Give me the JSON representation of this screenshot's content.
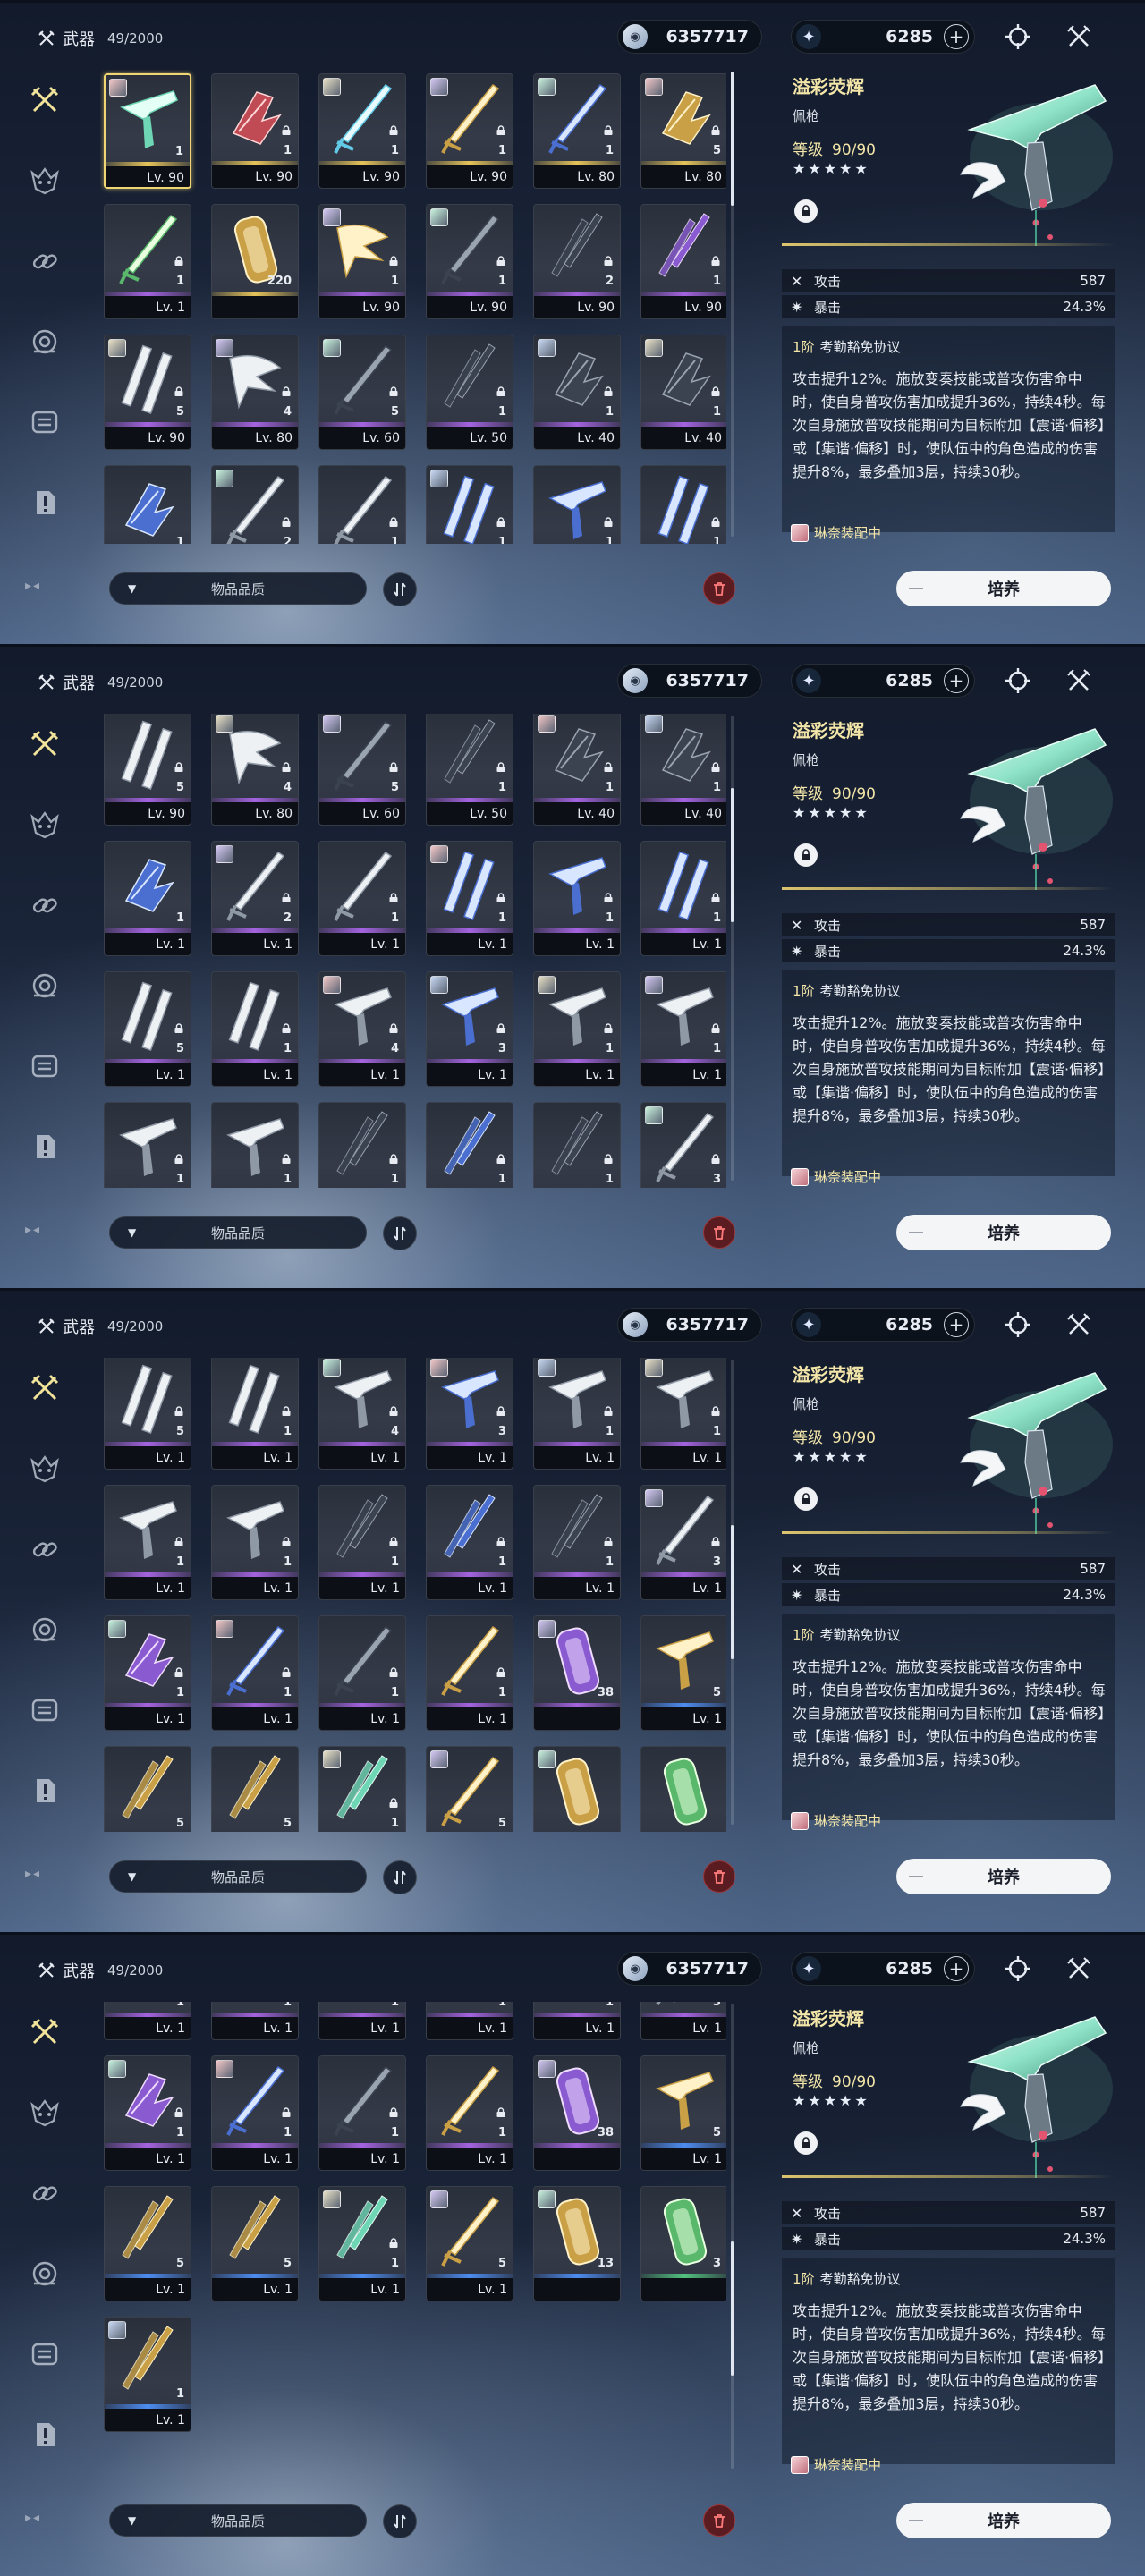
{
  "header": {
    "title": "武器",
    "count": "49/2000"
  },
  "currency": {
    "primary": "6357717",
    "secondary": "6285",
    "plus": "+"
  },
  "filter_label": "物品品质",
  "train_label": "培养",
  "detail": {
    "name": "溢彩荧辉",
    "type": "佩枪",
    "level_label": "等级",
    "level_value": "90/90",
    "stars": "★★★★★",
    "stats": [
      {
        "name": "攻击",
        "value": "587",
        "icon": "crossed-swords-icon"
      },
      {
        "name": "暴击",
        "value": "24.3%",
        "icon": "sparkle-icon"
      }
    ],
    "skill_rank": "1阶",
    "skill_name": "考勤豁免协议",
    "skill_text": "攻击提升12%。施放变奏技能或普攻伤害命中时，使自身普攻伤害加成提升36%，持续4秒。每次自身施放普攻技能期间为目标附加【震谐·偏移】或【集谐·偏移】时，使队伍中的角色造成的伤害提升8%，最多叠加3层，持续30秒。",
    "equipped_by": "琳奈装配中"
  },
  "colors": {
    "accent": "#f3e6a8",
    "r5": "#e6c35a",
    "r4": "#a463e0",
    "r3": "#4d8cf0",
    "r2": "#52c27f"
  },
  "sidebar_icons": [
    "crossed-swords-icon",
    "echo-mask-icon",
    "chain-link-icon",
    "resonance-icon",
    "material-icon",
    "notice-icon"
  ],
  "panels": [
    {
      "scroll": 0.0,
      "cards": [
        {
          "lv": "Lv. 90",
          "badge": "1",
          "r": "5",
          "av": 1,
          "sel": 1,
          "art": "pistol-teal"
        },
        {
          "lv": "Lv. 90",
          "badge": "1",
          "r": "5",
          "av": 0,
          "lock": 1,
          "art": "gauntlet-red"
        },
        {
          "lv": "Lv. 90",
          "badge": "1",
          "r": "5",
          "av": 1,
          "lock": 1,
          "art": "sword-cyan"
        },
        {
          "lv": "Lv. 90",
          "badge": "1",
          "r": "5",
          "av": 1,
          "lock": 1,
          "art": "sword-gold"
        },
        {
          "lv": "Lv. 80",
          "badge": "1",
          "r": "5",
          "av": 1,
          "lock": 1,
          "art": "sword-blue"
        },
        {
          "lv": "Lv. 80",
          "badge": "5",
          "r": "5",
          "av": 1,
          "lock": 1,
          "art": "gauntlet-gold"
        },
        {
          "lv": "Lv. 1",
          "badge": "1",
          "r": "4",
          "av": 0,
          "lock": 1,
          "art": "sword-green"
        },
        {
          "lv": "",
          "badge": "220",
          "r": "5",
          "av": 0,
          "lock": 0,
          "art": "capsule-gold"
        },
        {
          "lv": "Lv. 90",
          "badge": "1",
          "r": "4",
          "av": 1,
          "lock": 1,
          "art": "wing-gold"
        },
        {
          "lv": "Lv. 90",
          "badge": "1",
          "r": "4",
          "av": 1,
          "lock": 1,
          "art": "sword-dark"
        },
        {
          "lv": "Lv. 90",
          "badge": "2",
          "r": "4",
          "av": 0,
          "lock": 1,
          "art": "blade-dark"
        },
        {
          "lv": "Lv. 90",
          "badge": "1",
          "r": "4",
          "av": 0,
          "lock": 1,
          "art": "blade-purple"
        },
        {
          "lv": "Lv. 90",
          "badge": "5",
          "r": "4",
          "av": 1,
          "lock": 1,
          "art": "rectifier-gray"
        },
        {
          "lv": "Lv. 80",
          "badge": "4",
          "r": "4",
          "av": 1,
          "lock": 1,
          "art": "wing-gray"
        },
        {
          "lv": "Lv. 60",
          "badge": "5",
          "r": "4",
          "av": 1,
          "lock": 1,
          "art": "sword-dark"
        },
        {
          "lv": "Lv. 50",
          "badge": "1",
          "r": "4",
          "av": 0,
          "lock": 1,
          "art": "blade-dark"
        },
        {
          "lv": "Lv. 40",
          "badge": "1",
          "r": "4",
          "av": 1,
          "lock": 1,
          "art": "gauntlet-dark"
        },
        {
          "lv": "Lv. 40",
          "badge": "1",
          "r": "4",
          "av": 1,
          "lock": 1,
          "art": "gauntlet-dark"
        },
        {
          "lv": "",
          "badge": "1",
          "r": "4",
          "av": 0,
          "lock": 0,
          "art": "gauntlet-blue"
        },
        {
          "lv": "",
          "badge": "2",
          "r": "4",
          "av": 1,
          "lock": 1,
          "art": "sword-gray"
        },
        {
          "lv": "",
          "badge": "1",
          "r": "4",
          "av": 0,
          "lock": 1,
          "art": "sword-gray"
        },
        {
          "lv": "",
          "badge": "1",
          "r": "4",
          "av": 1,
          "lock": 1,
          "art": "rectifier-blue"
        },
        {
          "lv": "",
          "badge": "1",
          "r": "4",
          "av": 0,
          "lock": 1,
          "art": "pistol-blue"
        },
        {
          "lv": "",
          "badge": "1",
          "r": "4",
          "av": 0,
          "lock": 1,
          "art": "rectifier-blue"
        }
      ]
    },
    {
      "scroll": 0.22,
      "cards": [
        {
          "lv": "Lv. 90",
          "badge": "5",
          "r": "4",
          "av": 0,
          "lock": 1,
          "art": "rectifier-gray"
        },
        {
          "lv": "Lv. 80",
          "badge": "4",
          "r": "4",
          "av": 1,
          "lock": 1,
          "art": "wing-gray"
        },
        {
          "lv": "Lv. 60",
          "badge": "5",
          "r": "4",
          "av": 1,
          "lock": 1,
          "art": "sword-dark"
        },
        {
          "lv": "Lv. 50",
          "badge": "1",
          "r": "4",
          "av": 0,
          "lock": 1,
          "art": "blade-dark"
        },
        {
          "lv": "Lv. 40",
          "badge": "1",
          "r": "4",
          "av": 1,
          "lock": 1,
          "art": "gauntlet-dark"
        },
        {
          "lv": "Lv. 40",
          "badge": "1",
          "r": "4",
          "av": 1,
          "lock": 1,
          "art": "gauntlet-dark"
        },
        {
          "lv": "Lv. 1",
          "badge": "1",
          "r": "4",
          "av": 0,
          "lock": 0,
          "art": "gauntlet-blue"
        },
        {
          "lv": "Lv. 1",
          "badge": "2",
          "r": "4",
          "av": 1,
          "lock": 1,
          "art": "sword-gray"
        },
        {
          "lv": "Lv. 1",
          "badge": "1",
          "r": "4",
          "av": 0,
          "lock": 1,
          "art": "sword-gray"
        },
        {
          "lv": "Lv. 1",
          "badge": "1",
          "r": "4",
          "av": 1,
          "lock": 1,
          "art": "rectifier-blue"
        },
        {
          "lv": "Lv. 1",
          "badge": "1",
          "r": "4",
          "av": 0,
          "lock": 1,
          "art": "pistol-blue"
        },
        {
          "lv": "Lv. 1",
          "badge": "1",
          "r": "4",
          "av": 0,
          "lock": 1,
          "art": "rectifier-blue"
        },
        {
          "lv": "Lv. 1",
          "badge": "5",
          "r": "4",
          "av": 0,
          "lock": 1,
          "art": "rectifier-gray"
        },
        {
          "lv": "Lv. 1",
          "badge": "1",
          "r": "4",
          "av": 0,
          "lock": 1,
          "art": "rectifier-gray"
        },
        {
          "lv": "Lv. 1",
          "badge": "4",
          "r": "4",
          "av": 1,
          "lock": 1,
          "art": "pistol-gray"
        },
        {
          "lv": "Lv. 1",
          "badge": "3",
          "r": "4",
          "av": 1,
          "lock": 1,
          "art": "pistol-blue"
        },
        {
          "lv": "Lv. 1",
          "badge": "1",
          "r": "4",
          "av": 1,
          "lock": 1,
          "art": "pistol-gray"
        },
        {
          "lv": "Lv. 1",
          "badge": "1",
          "r": "4",
          "av": 1,
          "lock": 1,
          "art": "pistol-gray"
        },
        {
          "lv": "",
          "badge": "1",
          "r": "4",
          "av": 0,
          "lock": 1,
          "art": "pistol-gray"
        },
        {
          "lv": "",
          "badge": "1",
          "r": "4",
          "av": 0,
          "lock": 1,
          "art": "pistol-gray"
        },
        {
          "lv": "",
          "badge": "1",
          "r": "4",
          "av": 0,
          "lock": 1,
          "art": "blade-dark"
        },
        {
          "lv": "",
          "badge": "1",
          "r": "4",
          "av": 0,
          "lock": 1,
          "art": "blade-blue"
        },
        {
          "lv": "",
          "badge": "1",
          "r": "4",
          "av": 0,
          "lock": 1,
          "art": "blade-dark"
        },
        {
          "lv": "",
          "badge": "3",
          "r": "4",
          "av": 1,
          "lock": 1,
          "art": "sword-gray"
        }
      ]
    },
    {
      "scroll": 0.5,
      "cards": [
        {
          "lv": "Lv. 1",
          "badge": "5",
          "r": "4",
          "av": 0,
          "lock": 1,
          "art": "rectifier-gray"
        },
        {
          "lv": "Lv. 1",
          "badge": "1",
          "r": "4",
          "av": 0,
          "lock": 1,
          "art": "rectifier-gray"
        },
        {
          "lv": "Lv. 1",
          "badge": "4",
          "r": "4",
          "av": 1,
          "lock": 1,
          "art": "pistol-gray"
        },
        {
          "lv": "Lv. 1",
          "badge": "3",
          "r": "4",
          "av": 1,
          "lock": 1,
          "art": "pistol-blue"
        },
        {
          "lv": "Lv. 1",
          "badge": "1",
          "r": "4",
          "av": 1,
          "lock": 1,
          "art": "pistol-gray"
        },
        {
          "lv": "Lv. 1",
          "badge": "1",
          "r": "4",
          "av": 1,
          "lock": 1,
          "art": "pistol-gray"
        },
        {
          "lv": "Lv. 1",
          "badge": "1",
          "r": "4",
          "av": 0,
          "lock": 1,
          "art": "pistol-gray"
        },
        {
          "lv": "Lv. 1",
          "badge": "1",
          "r": "4",
          "av": 0,
          "lock": 1,
          "art": "pistol-gray"
        },
        {
          "lv": "Lv. 1",
          "badge": "1",
          "r": "4",
          "av": 0,
          "lock": 1,
          "art": "blade-dark"
        },
        {
          "lv": "Lv. 1",
          "badge": "1",
          "r": "4",
          "av": 0,
          "lock": 1,
          "art": "blade-blue"
        },
        {
          "lv": "Lv. 1",
          "badge": "1",
          "r": "4",
          "av": 0,
          "lock": 1,
          "art": "blade-dark"
        },
        {
          "lv": "Lv. 1",
          "badge": "3",
          "r": "4",
          "av": 1,
          "lock": 1,
          "art": "sword-gray"
        },
        {
          "lv": "Lv. 1",
          "badge": "1",
          "r": "4",
          "av": 1,
          "lock": 1,
          "art": "gauntlet-purple"
        },
        {
          "lv": "Lv. 1",
          "badge": "1",
          "r": "4",
          "av": 1,
          "lock": 1,
          "art": "sword-blue"
        },
        {
          "lv": "Lv. 1",
          "badge": "1",
          "r": "4",
          "av": 0,
          "lock": 1,
          "art": "sword-dark"
        },
        {
          "lv": "Lv. 1",
          "badge": "1",
          "r": "4",
          "av": 0,
          "lock": 1,
          "art": "sword-gold"
        },
        {
          "lv": "",
          "badge": "38",
          "r": "4",
          "av": 1,
          "lock": 0,
          "art": "capsule-purple"
        },
        {
          "lv": "Lv. 1",
          "badge": "5",
          "r": "3",
          "av": 0,
          "lock": 0,
          "art": "pistol-gold"
        },
        {
          "lv": "",
          "badge": "5",
          "r": "3",
          "av": 0,
          "lock": 0,
          "art": "blade-gold"
        },
        {
          "lv": "",
          "badge": "5",
          "r": "3",
          "av": 0,
          "lock": 0,
          "art": "blade-gold"
        },
        {
          "lv": "",
          "badge": "1",
          "r": "3",
          "av": 1,
          "lock": 1,
          "art": "blade-teal"
        },
        {
          "lv": "",
          "badge": "5",
          "r": "3",
          "av": 1,
          "lock": 0,
          "art": "sword-gold"
        },
        {
          "lv": "",
          "badge": "",
          "r": "3",
          "av": 1,
          "lock": 0,
          "art": "capsule-gold"
        },
        {
          "lv": "",
          "badge": "",
          "r": "2",
          "av": 0,
          "lock": 0,
          "art": "capsule-green"
        }
      ]
    },
    {
      "scroll": 0.72,
      "cards": [
        {
          "lv": "Lv. 1",
          "badge": "1",
          "r": "4",
          "av": 0,
          "lock": 1,
          "art": "pistol-gray"
        },
        {
          "lv": "Lv. 1",
          "badge": "1",
          "r": "4",
          "av": 0,
          "lock": 1,
          "art": "pistol-gray"
        },
        {
          "lv": "Lv. 1",
          "badge": "1",
          "r": "4",
          "av": 0,
          "lock": 1,
          "art": "blade-dark"
        },
        {
          "lv": "Lv. 1",
          "badge": "1",
          "r": "4",
          "av": 0,
          "lock": 1,
          "art": "blade-blue"
        },
        {
          "lv": "Lv. 1",
          "badge": "1",
          "r": "4",
          "av": 0,
          "lock": 1,
          "art": "blade-dark"
        },
        {
          "lv": "Lv. 1",
          "badge": "3",
          "r": "4",
          "av": 1,
          "lock": 1,
          "art": "sword-gray"
        },
        {
          "lv": "Lv. 1",
          "badge": "1",
          "r": "4",
          "av": 1,
          "lock": 1,
          "art": "gauntlet-purple"
        },
        {
          "lv": "Lv. 1",
          "badge": "1",
          "r": "4",
          "av": 1,
          "lock": 1,
          "art": "sword-blue"
        },
        {
          "lv": "Lv. 1",
          "badge": "1",
          "r": "4",
          "av": 0,
          "lock": 1,
          "art": "sword-dark"
        },
        {
          "lv": "Lv. 1",
          "badge": "1",
          "r": "4",
          "av": 0,
          "lock": 1,
          "art": "sword-gold"
        },
        {
          "lv": "",
          "badge": "38",
          "r": "4",
          "av": 1,
          "lock": 0,
          "art": "capsule-purple"
        },
        {
          "lv": "Lv. 1",
          "badge": "5",
          "r": "3",
          "av": 0,
          "lock": 0,
          "art": "pistol-gold"
        },
        {
          "lv": "Lv. 1",
          "badge": "5",
          "r": "3",
          "av": 0,
          "lock": 0,
          "art": "blade-gold"
        },
        {
          "lv": "Lv. 1",
          "badge": "5",
          "r": "3",
          "av": 0,
          "lock": 0,
          "art": "blade-gold"
        },
        {
          "lv": "Lv. 1",
          "badge": "1",
          "r": "3",
          "av": 1,
          "lock": 1,
          "art": "blade-teal"
        },
        {
          "lv": "Lv. 1",
          "badge": "5",
          "r": "3",
          "av": 1,
          "lock": 0,
          "art": "sword-gold"
        },
        {
          "lv": "",
          "badge": "13",
          "r": "3",
          "av": 1,
          "lock": 0,
          "art": "capsule-gold"
        },
        {
          "lv": "",
          "badge": "3",
          "r": "2",
          "av": 0,
          "lock": 0,
          "art": "capsule-green"
        },
        {
          "lv": "Lv. 1",
          "badge": "1",
          "r": "3",
          "av": 1,
          "lock": 0,
          "art": "blade-gold"
        }
      ]
    }
  ]
}
